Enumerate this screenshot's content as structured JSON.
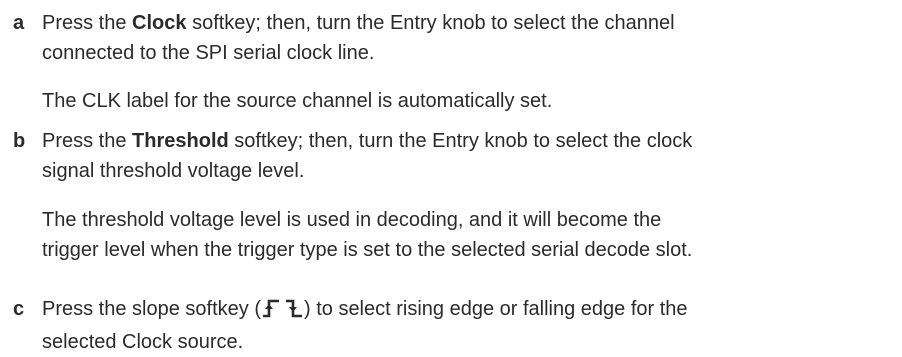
{
  "steps": [
    {
      "letter": "a",
      "line1": {
        "pre": "Press the ",
        "key": "Clock",
        "post": " softkey; then, turn the Entry knob to select the channel"
      },
      "line2": "connected to the SPI serial clock line.",
      "note": [
        "The CLK label for the source channel is automatically set."
      ]
    },
    {
      "letter": "b",
      "line1": {
        "pre": "Press the ",
        "key": "Threshold",
        "post": " softkey; then, turn the Entry knob to select the clock"
      },
      "line2": "signal threshold voltage level.",
      "note": [
        "The threshold voltage level is used in decoding, and it will become the",
        "trigger level when the trigger type is set to the selected serial decode slot."
      ]
    },
    {
      "letter": "c",
      "line1": {
        "pre": "Press the slope softkey (",
        "icons": [
          "rising-edge-icon",
          "falling-edge-icon"
        ],
        "post": ") to select rising edge or falling edge for the"
      },
      "line2": "selected Clock source."
    }
  ]
}
